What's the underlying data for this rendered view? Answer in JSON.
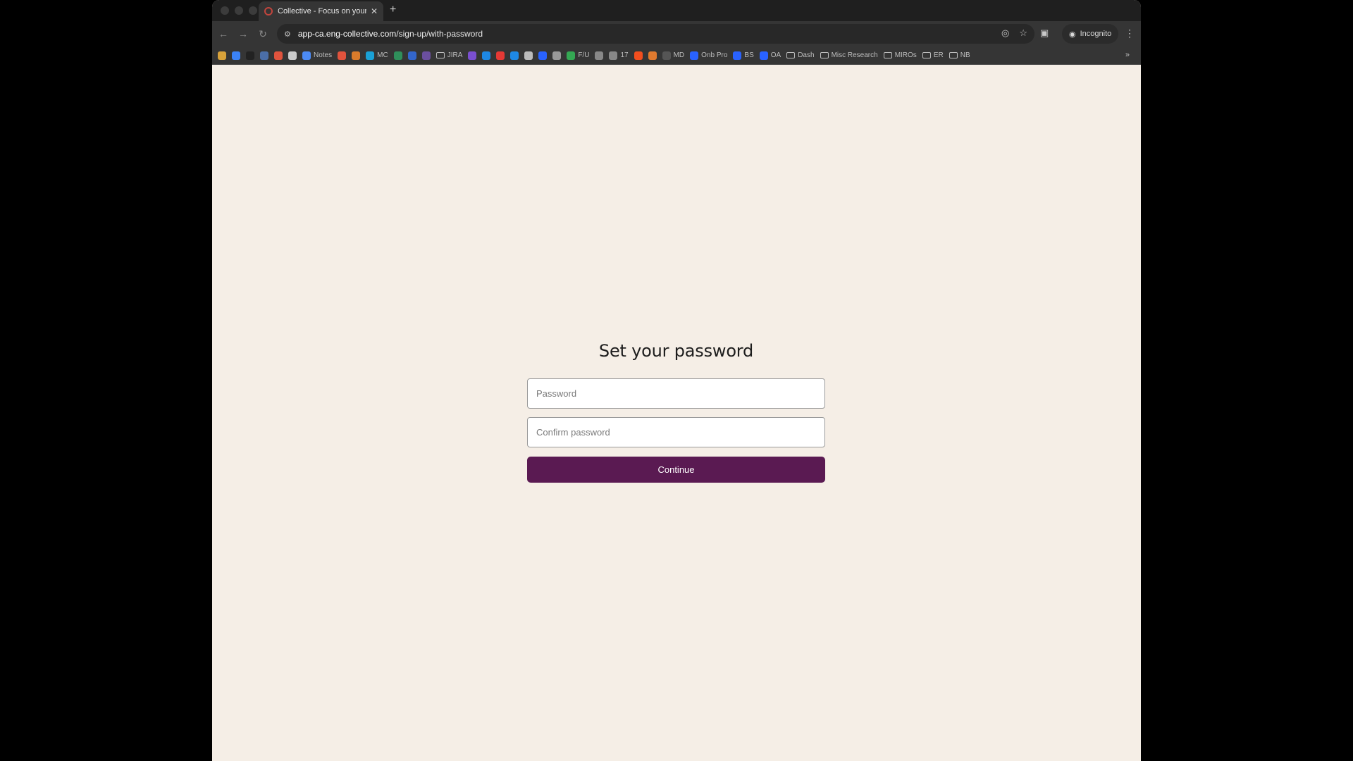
{
  "browser": {
    "tab_title": "Collective - Focus on your pa",
    "url_host": "app-ca.eng-collective.com",
    "url_path": "/sign-up/with-password",
    "incognito_label": "Incognito",
    "bookmarks": [
      {
        "label": "",
        "color": "#d8a23a"
      },
      {
        "label": "",
        "color": "#3b82f6"
      },
      {
        "label": "",
        "color": "#222222"
      },
      {
        "label": "",
        "color": "#4b6ea8"
      },
      {
        "label": "",
        "color": "#e0533d"
      },
      {
        "label": "",
        "color": "#cccccc"
      },
      {
        "label": "Notes",
        "color": "#4c8bf5"
      },
      {
        "label": "",
        "color": "#e0533d"
      },
      {
        "label": "",
        "color": "#d97b2b"
      },
      {
        "label": "MC",
        "color": "#1aa1d6"
      },
      {
        "label": "",
        "color": "#2f8f5b"
      },
      {
        "label": "",
        "color": "#3366cc"
      },
      {
        "label": "",
        "color": "#6b4f9e"
      },
      {
        "label": "JIRA",
        "folder": true
      },
      {
        "label": "",
        "color": "#7a4fd0"
      },
      {
        "label": "",
        "color": "#1e88e5"
      },
      {
        "label": "",
        "color": "#e53935"
      },
      {
        "label": "",
        "color": "#1e88e5"
      },
      {
        "label": "",
        "color": "#bbbbbb"
      },
      {
        "label": "",
        "color": "#2962ff"
      },
      {
        "label": "",
        "color": "#999999"
      },
      {
        "label": "F/U",
        "color": "#34a853"
      },
      {
        "label": "",
        "color": "#888888"
      },
      {
        "label": "17",
        "color": "#888888"
      },
      {
        "label": "",
        "color": "#f24e1e"
      },
      {
        "label": "",
        "color": "#e07a2f"
      },
      {
        "label": "MD",
        "color": "#555555"
      },
      {
        "label": "Onb Pro",
        "color": "#2962ff"
      },
      {
        "label": "BS",
        "color": "#2962ff"
      },
      {
        "label": "OA",
        "color": "#2962ff"
      },
      {
        "label": "Dash",
        "folder": true
      },
      {
        "label": "Misc Research",
        "folder": true
      },
      {
        "label": "MIROs",
        "folder": true
      },
      {
        "label": "ER",
        "folder": true
      },
      {
        "label": "NB",
        "folder": true
      }
    ]
  },
  "form": {
    "heading": "Set your password",
    "password_placeholder": "Password",
    "confirm_placeholder": "Confirm password",
    "continue_label": "Continue"
  },
  "colors": {
    "page_background": "#f5eee6",
    "primary_button": "#5a1a52"
  }
}
